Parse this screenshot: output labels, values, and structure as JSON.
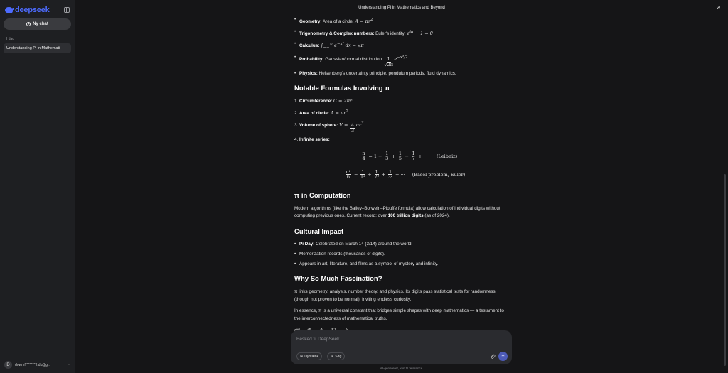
{
  "sidebar": {
    "logo_text": "deepseek",
    "new_chat_label": "Ny chat",
    "day_label": "I dag",
    "history": [
      {
        "title": "Understanding Pi in Mathematics and Beyond"
      }
    ],
    "user_initial": "D",
    "user_email": "dowmf********l.dk@g..."
  },
  "header": {
    "title": "Understanding Pi in Mathematics and Beyond"
  },
  "content": {
    "applications": [
      {
        "label": "Geometry:",
        "text": "Area of a circle: ",
        "math": "A = πr²"
      },
      {
        "label": "Trigonometry & Complex numbers:",
        "text": "Euler's identity: ",
        "math": "e^{iπ} + 1 = 0"
      },
      {
        "label": "Calculus:",
        "text": "",
        "math": "∫₋∞^∞ e^{−x²} dx = √π"
      },
      {
        "label": "Probability:",
        "text": "Gaussian/normal distribution ",
        "math": "1/√(2π) e^{−x²/2}"
      },
      {
        "label": "Physics:",
        "text": "Heisenberg's uncertainty principle, pendulum periods, fluid dynamics.",
        "math": ""
      }
    ],
    "formulas_heading": "Notable Formulas Involving π",
    "formulas": [
      {
        "num": "1.",
        "label": "Circumference:",
        "math": "C = 2πr"
      },
      {
        "num": "2.",
        "label": "Area of circle:",
        "math": "A = πr²"
      },
      {
        "num": "3.",
        "label": "Volume of sphere:",
        "math": "V = ⁴⁄₃πr³"
      },
      {
        "num": "4.",
        "label": "Infinite series:",
        "math": ""
      }
    ],
    "leibniz_note": "(Leibniz)",
    "basel_note": "(Basel problem, Euler)",
    "computation_heading": "π in Computation",
    "computation_text_1": "Modern algorithms (like the Bailey–Borwein–Plouffe formula) allow calculation of individual digits without computing previous ones. Current record: over ",
    "computation_bold": "100 trillion digits",
    "computation_text_2": " (as of 2024).",
    "cultural_heading": "Cultural Impact",
    "cultural": [
      {
        "label": "Pi Day:",
        "text": " Celebrated on March 14 (3/14) around the world."
      },
      {
        "label": "",
        "text": "Memorization records (thousands of digits)."
      },
      {
        "label": "",
        "text": "Appears in art, literature, and films as a symbol of mystery and infinity."
      }
    ],
    "fascination_heading": "Why So Much Fascination?",
    "fascination_p1": "π links geometry, analysis, number theory, and physics. Its digits pass statistical tests for randomness (though not proven to be normal), inviting endless curiosity.",
    "fascination_p2": "In essence, π is a universal constant that bridges simple shapes with deep mathematics — a testament to the interconnectedness of mathematical truths."
  },
  "composer": {
    "placeholder": "Besked til DeepSeek",
    "deepthink_label": "Dybtænk",
    "search_label": "Søg"
  },
  "footer_note": "AI-genereret, kun til reference",
  "colors": {
    "accent": "#4d6bfe",
    "background": "#151517",
    "sidebar": "#1e1f22"
  }
}
